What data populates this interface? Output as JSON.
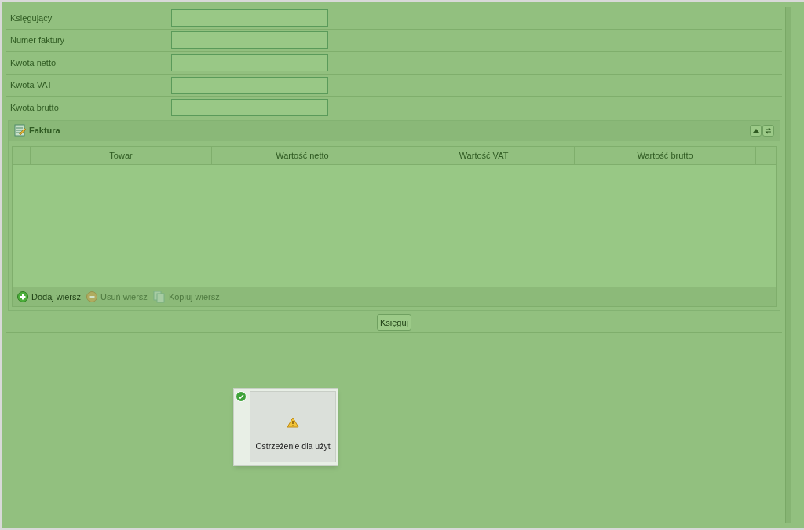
{
  "form_fields": [
    {
      "label": "Księgujący"
    },
    {
      "label": "Numer faktury"
    },
    {
      "label": "Kwota netto"
    },
    {
      "label": "Kwota VAT"
    },
    {
      "label": "Kwota brutto"
    }
  ],
  "panel": {
    "title": "Faktura",
    "columns": [
      "Towar",
      "Wartość netto",
      "Wartość VAT",
      "Wartość brutto"
    ],
    "toolbar": [
      {
        "kind": "add",
        "label": "Dodaj wiersz",
        "disabled": false
      },
      {
        "kind": "remove",
        "label": "Usuń wiersz",
        "disabled": true
      },
      {
        "kind": "copy",
        "label": "Kopiuj wiersz",
        "disabled": true
      }
    ]
  },
  "submit_button": "Księguj",
  "notification": {
    "text": "Ostrzeżenie dla użyt"
  }
}
